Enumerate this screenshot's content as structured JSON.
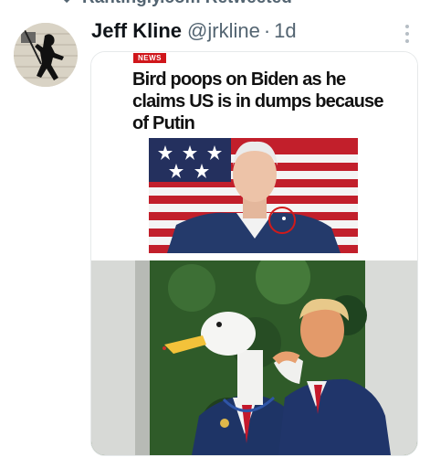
{
  "retweet": {
    "icon": "retweet-icon",
    "text": "Rantingly.com Retweeted"
  },
  "tweet": {
    "author_name": "Jeff Kline",
    "handle": "@jrkline",
    "separator": "·",
    "time": "1d",
    "more_icon": "more-icon",
    "avatar": "avatar"
  },
  "media": {
    "news": {
      "badge": "NEWS",
      "headline": "Bird poops on Biden as he claims US is in dumps because of Putin"
    }
  },
  "colors": {
    "text": "#0f1419",
    "secondary": "#536471",
    "badge": "#d0161b"
  }
}
